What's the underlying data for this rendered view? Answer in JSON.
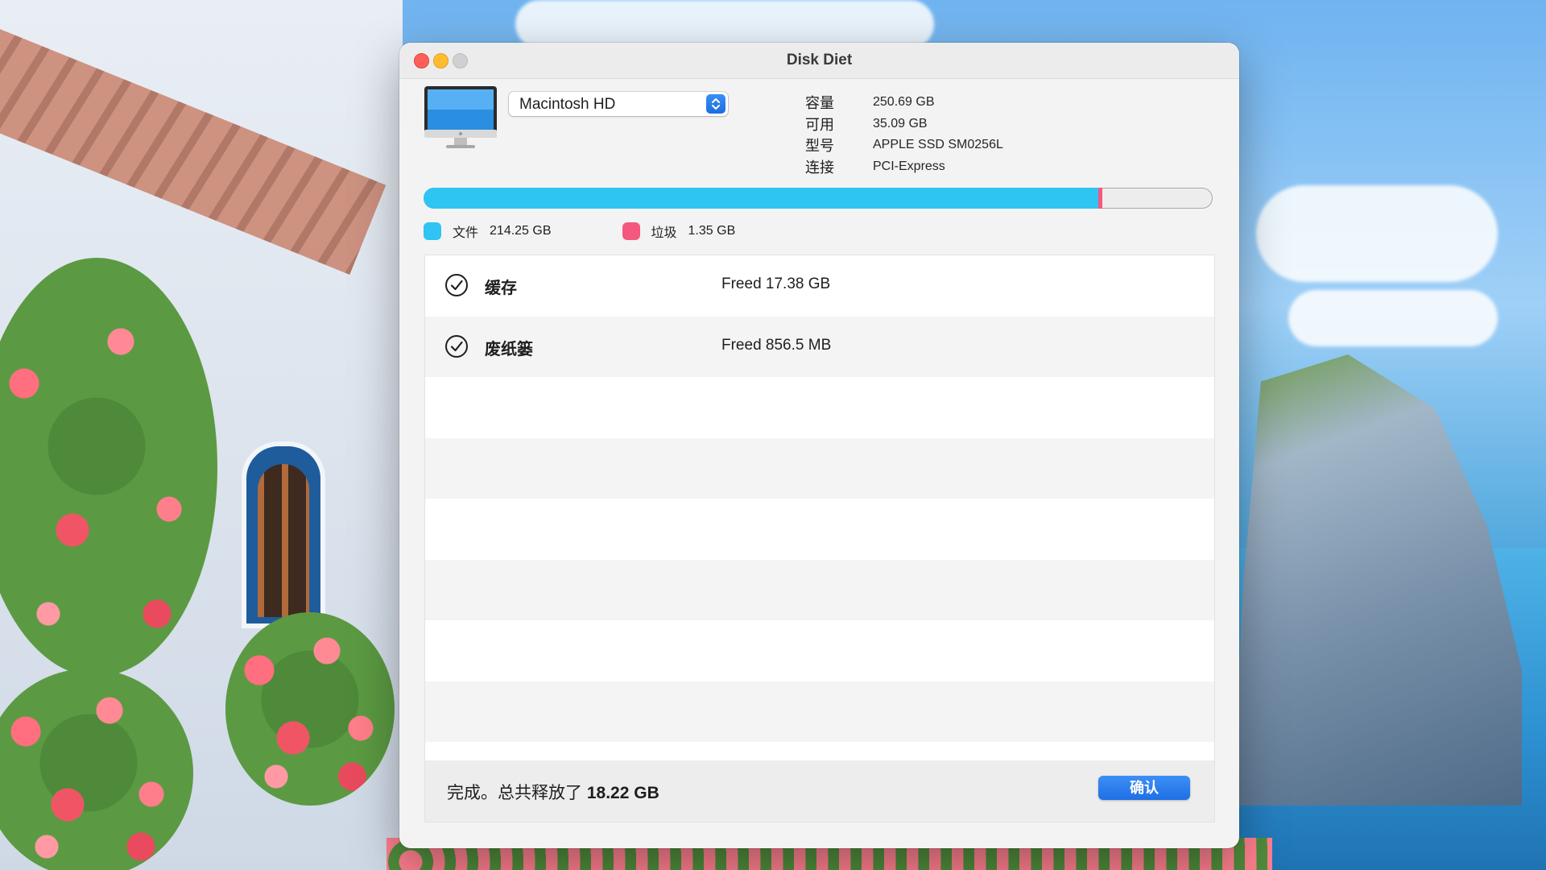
{
  "app": {
    "title": "Disk Diet"
  },
  "disk_selector": {
    "selected": "Macintosh HD"
  },
  "disk_info": [
    {
      "label": "容量",
      "value": "250.69 GB"
    },
    {
      "label": "可用",
      "value": "35.09 GB"
    },
    {
      "label": "型号",
      "value": "APPLE SSD SM0256L"
    },
    {
      "label": "连接",
      "value": "PCI-Express"
    }
  ],
  "usage": {
    "files_fraction": 0.855,
    "trash_fraction": 0.0054,
    "files_color": "#2fc4f2",
    "trash_color": "#f4587f"
  },
  "legend": [
    {
      "label": "文件",
      "value": "214.25 GB",
      "color": "#2fc4f2"
    },
    {
      "label": "垃圾",
      "value": "1.35 GB",
      "color": "#f4587f"
    }
  ],
  "results": [
    {
      "icon": "checkmark-circle-icon",
      "name": "缓存",
      "status": "Freed 17.38 GB"
    },
    {
      "icon": "checkmark-circle-icon",
      "name": "废纸篓",
      "status": "Freed 856.5 MB"
    }
  ],
  "footer": {
    "message": "完成。总共释放了",
    "total": "18.22 GB",
    "ok_label": "确认"
  }
}
